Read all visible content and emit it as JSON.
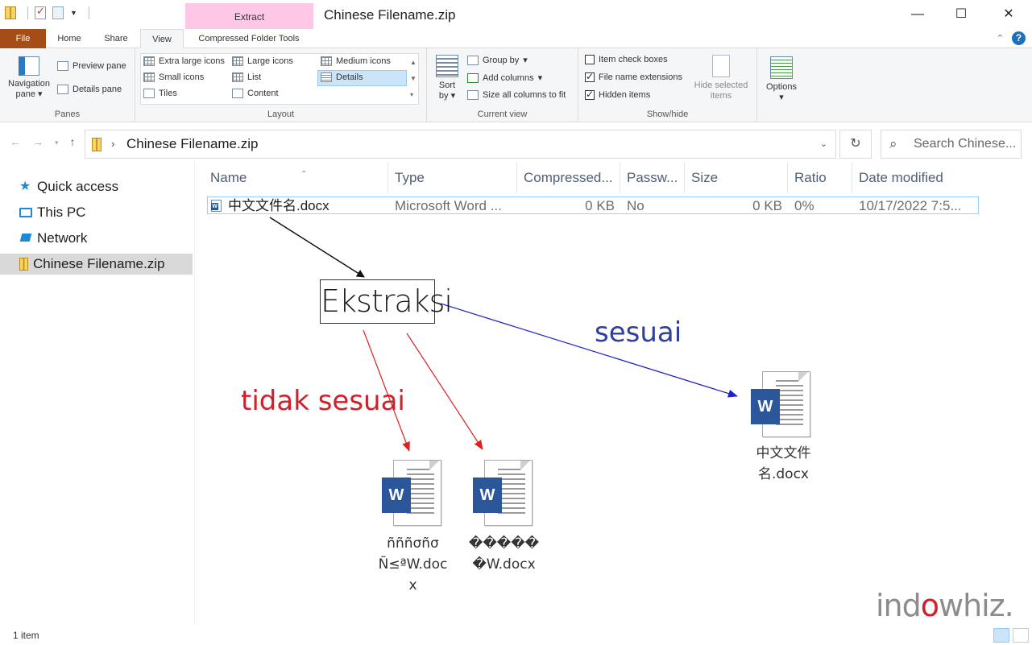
{
  "window": {
    "title": "Chinese Filename.zip",
    "context_group": "Extract",
    "context_tab": "Compressed Folder Tools",
    "controls": [
      "—",
      "☐",
      "✕"
    ]
  },
  "tabs": {
    "file": "File",
    "home": "Home",
    "share": "Share",
    "view": "View"
  },
  "ribbon": {
    "panes": {
      "navigation_pane": "Navigation pane",
      "preview_pane": "Preview pane",
      "details_pane": "Details pane",
      "label": "Panes"
    },
    "layout": {
      "extra_large_icons": "Extra large icons",
      "large_icons": "Large icons",
      "medium_icons": "Medium icons",
      "small_icons": "Small icons",
      "list": "List",
      "details": "Details",
      "tiles": "Tiles",
      "content": "Content",
      "label": "Layout",
      "selected": "Details"
    },
    "current_view": {
      "sort_by": "Sort by",
      "group_by": "Group by",
      "add_columns": "Add columns",
      "size_all_columns": "Size all columns to fit",
      "label": "Current view"
    },
    "show_hide": {
      "item_check_boxes": "Item check boxes",
      "file_name_extensions": "File name extensions",
      "hidden_items": "Hidden items",
      "hide_selected": "Hide selected items",
      "label": "Show/hide",
      "item_check_boxes_checked": false,
      "file_name_extensions_checked": true,
      "hidden_items_checked": true
    },
    "options": "Options"
  },
  "address": {
    "path": "Chinese Filename.zip",
    "search_placeholder": "Search Chinese..."
  },
  "nav": {
    "items": [
      {
        "label": "Quick access",
        "icon": "star-icon"
      },
      {
        "label": "This PC",
        "icon": "pc-icon"
      },
      {
        "label": "Network",
        "icon": "network-icon"
      },
      {
        "label": "Chinese Filename.zip",
        "icon": "zip-icon",
        "selected": true
      }
    ]
  },
  "list": {
    "columns": [
      "Name",
      "Type",
      "Compressed...",
      "Passw...",
      "Size",
      "Ratio",
      "Date modified"
    ],
    "rows": [
      {
        "name": "中文文件名.docx",
        "type": "Microsoft Word ...",
        "compressed": "0 KB",
        "password": "No",
        "size": "0 KB",
        "ratio": "0%",
        "date": "10/17/2022 7:5..."
      }
    ]
  },
  "diagram": {
    "box": "Ekstraksi",
    "match_label": "sesuai",
    "mismatch_label": "tidak sesuai",
    "docs": {
      "correct_line1": "中文文件",
      "correct_line2": "名.docx",
      "bad1_line1": "ñññσñσ",
      "bad1_line2": "Ñ≤ªW.doc",
      "bad1_line3": "x",
      "bad2_line1": "�����",
      "bad2_line2": "�W.docx"
    },
    "colors": {
      "match": "#2e3f9e",
      "mismatch": "#d0202a",
      "neutral": "#111111"
    }
  },
  "watermark": {
    "pre": "ind",
    "o": "o",
    "post": "whiz."
  },
  "status": {
    "items": "1 item"
  }
}
